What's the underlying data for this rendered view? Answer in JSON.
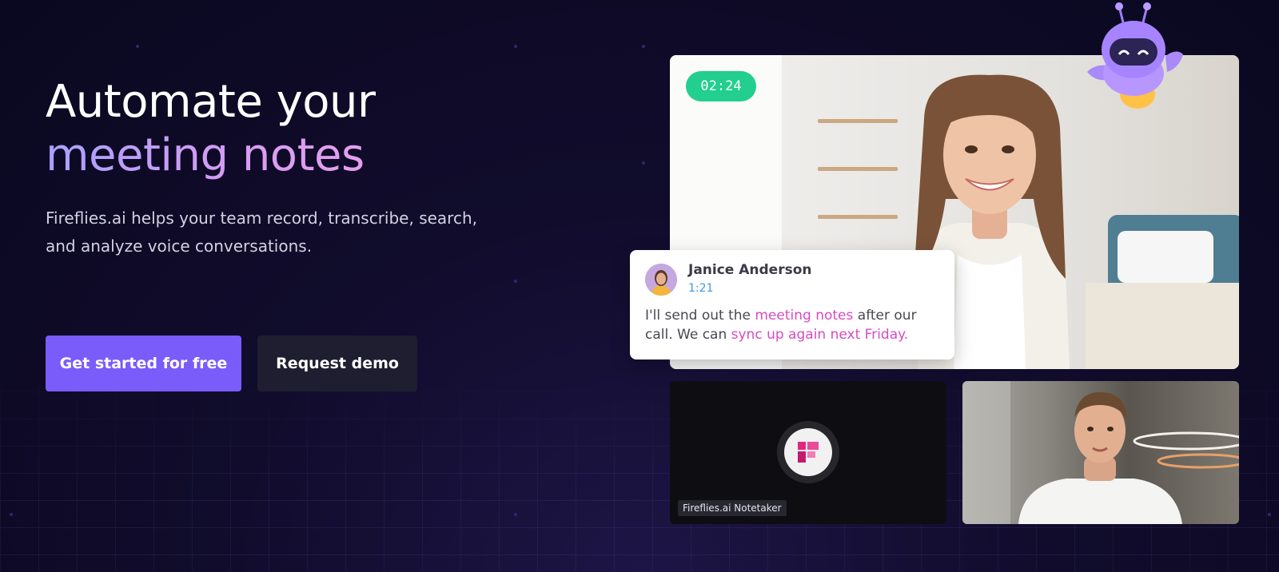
{
  "hero": {
    "title_line1": "Automate your",
    "title_line2": "meeting notes",
    "subtitle": "Fireflies.ai helps your team record, transcribe, search, and analyze voice conversations.",
    "primary_cta": "Get started for free",
    "secondary_cta": "Request demo"
  },
  "meeting": {
    "timer": "02:24",
    "transcript": {
      "speaker": "Janice Anderson",
      "time": "1:21",
      "text_part1": "I'll send out the ",
      "highlight1": "meeting notes",
      "text_part2": " after our call. We can ",
      "highlight2": "sync up again next Friday."
    },
    "notetaker_label": "Fireflies.ai Notetaker"
  },
  "colors": {
    "accent": "#7a5cfa",
    "timer": "#22cf8e",
    "highlight": "#d64bc3",
    "time_link": "#3b9be0",
    "brand_pink": "#e0287f"
  },
  "icons": [
    "robot-mascot-icon",
    "fireflies-logo-icon",
    "avatar"
  ]
}
